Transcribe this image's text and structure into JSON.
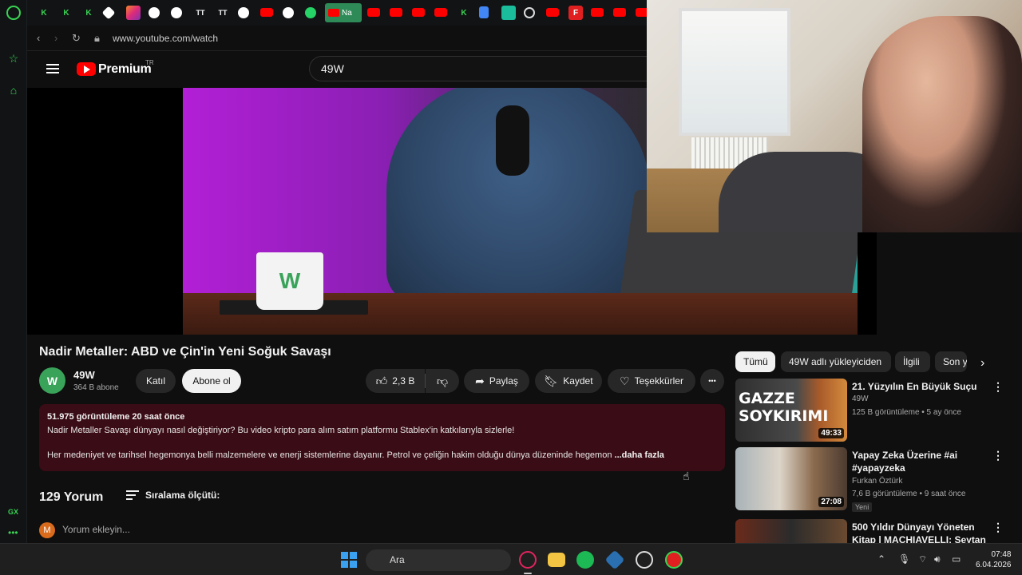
{
  "browser": {
    "url": "www.youtube.com/watch",
    "active_tab_label": "Na",
    "gx_label": "GX"
  },
  "youtube": {
    "brand": "Premium",
    "region": "TR",
    "search_value": "49W"
  },
  "video": {
    "title": "Nadir Metaller: ABD ve Çin'in Yeni Soğuk Savaşı",
    "mug_logo": "W"
  },
  "channel": {
    "avatar_letter": "W",
    "name": "49W",
    "subscribers": "364 B abone",
    "join_label": "Katıl",
    "subscribe_label": "Abone ol"
  },
  "actions": {
    "likes": "2,3 B",
    "share": "Paylaş",
    "save": "Kaydet",
    "thanks": "Teşekkürler",
    "more": "•••"
  },
  "description": {
    "meta": "51.975 görüntüleme  20 saat önce",
    "line1": "Nadir Metaller Savaşı dünyayı nasıl değiştiriyor? Bu video kripto para alım satım platformu Stablex'in katkılarıyla sizlerle!",
    "line2": "Her medeniyet ve tarihsel hegemonya belli malzemelere ve enerji sistemlerine dayanır. Petrol ve çeliğin hakim olduğu dünya düzeninde hegemon ",
    "more": "...daha fazla"
  },
  "comments": {
    "count": "129 Yorum",
    "sort_label": "Sıralama ölçütü:",
    "avatar_letter": "M",
    "placeholder": "Yorum ekleyin..."
  },
  "chips": [
    "Tümü",
    "49W adlı yükleyiciden",
    "İlgili",
    "Son y"
  ],
  "recommendations": [
    {
      "title": "21. Yüzyılın En Büyük Suçu",
      "channel": "49W",
      "meta": "125 B görüntüleme • 5 ay önce",
      "duration": "49:33",
      "thumb_text": "GAZZE SOYKIRIMI",
      "badge": ""
    },
    {
      "title": "Yapay Zeka Üzerine #ai #yapayzeka",
      "channel": "Furkan Öztürk",
      "meta": "7,6 B görüntüleme • 9 saat önce",
      "duration": "27:08",
      "thumb_text": "",
      "badge": "Yeni"
    },
    {
      "title": "500 Yıldır Dünyayı Yöneten Kitap | MACHIAVELLI: Şeytan ...",
      "channel": "",
      "meta": "",
      "duration": "",
      "thumb_text": "",
      "badge": ""
    }
  ],
  "taskbar": {
    "search_label": "Ara",
    "time": "07:48",
    "date": "6.04.2026"
  },
  "colors": {
    "accent_green": "#39d353",
    "youtube_red": "#ff0000",
    "description_bg": "#3a0c15"
  }
}
